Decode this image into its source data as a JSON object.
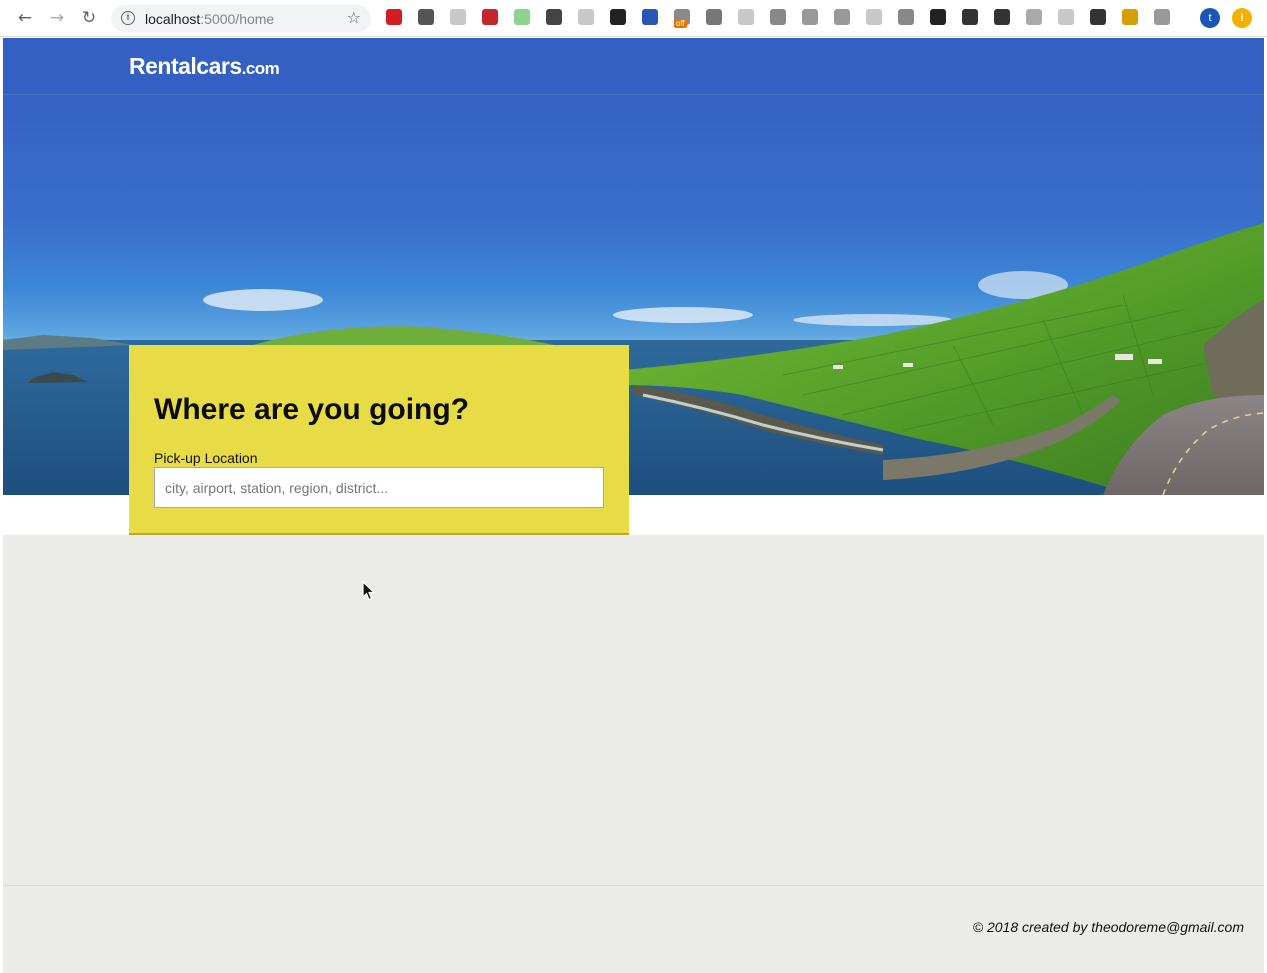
{
  "browser": {
    "url_host": "localhost",
    "url_path": ":5000/home",
    "back_glyph": "←",
    "forward_glyph": "→",
    "reload_glyph": "↻",
    "star_glyph": "☆",
    "info_glyph": "i",
    "extensions": [
      {
        "name": "opera-icon",
        "color": "#d01c22"
      },
      {
        "name": "angular-icon",
        "color": "#555"
      },
      {
        "name": "ghost-icon",
        "color": "#c8c8c8"
      },
      {
        "name": "puzzle-red-icon",
        "color": "#c1272d"
      },
      {
        "name": "globe-green-icon",
        "color": "#8fd18f"
      },
      {
        "name": "sync-icon",
        "color": "#444"
      },
      {
        "name": "chat-icon",
        "color": "#c8c8c8"
      },
      {
        "name": "spy-icon",
        "color": "#222"
      },
      {
        "name": "pen-tool-icon",
        "color": "#2a56b8"
      },
      {
        "name": "castle-icon",
        "color": "#8a8a8a",
        "badge": "off"
      },
      {
        "name": "code-icon",
        "color": "#777"
      },
      {
        "name": "rings-icon",
        "color": "#c8c8c8"
      },
      {
        "name": "rocket-icon",
        "color": "#888"
      },
      {
        "name": "brackets-icon",
        "color": "#999"
      },
      {
        "name": "target-icon",
        "color": "#999"
      },
      {
        "name": "robot-icon",
        "color": "#c8c8c8"
      },
      {
        "name": "cards-icon",
        "color": "#888"
      },
      {
        "name": "hand-icon",
        "color": "#222"
      },
      {
        "name": "github-icon",
        "color": "#333"
      },
      {
        "name": "json-icon",
        "color": "#333"
      },
      {
        "name": "puzzle-grey-icon",
        "color": "#aaa"
      },
      {
        "name": "angular-grey-icon",
        "color": "#c8c8c8"
      },
      {
        "name": "image-icon",
        "color": "#333"
      },
      {
        "name": "user-secret-icon",
        "color": "#d4a000"
      },
      {
        "name": "counter-icon",
        "color": "#999"
      }
    ],
    "profile_initial": "t",
    "alert_glyph": "!"
  },
  "header": {
    "logo_main": "Rentalcars",
    "logo_tld": ".com"
  },
  "search": {
    "title": "Where are you going?",
    "pickup_label": "Pick-up Location",
    "pickup_placeholder": "city, airport, station, region, district..."
  },
  "footer": {
    "text": "© 2018 created by theodoreme@gmail.com"
  },
  "colors": {
    "header_bg": "#3460c3",
    "card_bg": "#e7dc45",
    "page_bg": "#ebecea"
  }
}
